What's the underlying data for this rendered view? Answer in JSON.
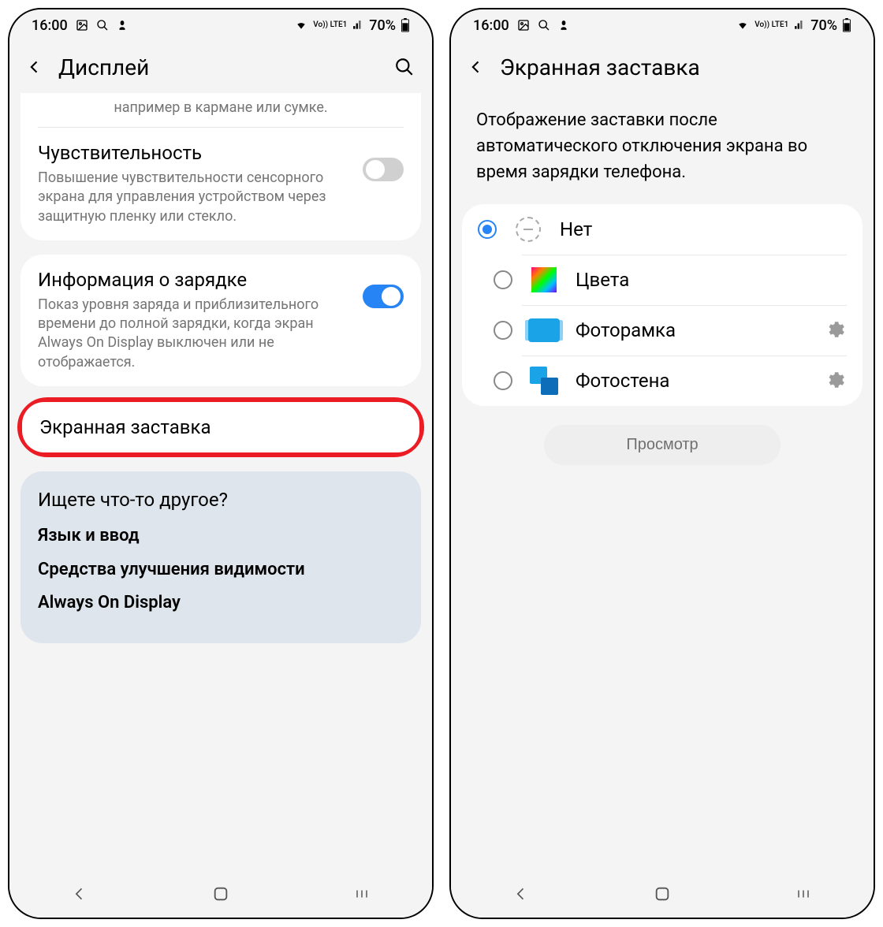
{
  "statusbar": {
    "time": "16:00",
    "network_label": "Vo)) LTE1",
    "battery": "70%"
  },
  "left": {
    "title": "Дисплей",
    "truncated": "например в кармане или сумке.",
    "sensitivity": {
      "title": "Чувствительность",
      "desc": "Повышение чувствительности сенсорного экрана для управления устройством через защитную пленку или стекло."
    },
    "charging": {
      "title": "Информация о зарядке",
      "desc": "Показ уровня заряда и приблизительного времени до полной зарядки, когда экран Always On Display выключен или не отображается."
    },
    "screensaver": {
      "title": "Экранная заставка"
    },
    "hints": {
      "title": "Ищете что-то другое?",
      "item1": "Язык и ввод",
      "item2": "Средства улучшения видимости",
      "item3": "Always On Display"
    }
  },
  "right": {
    "title": "Экранная заставка",
    "desc": "Отображение заставки после автоматического отключения экрана во время зарядки телефона.",
    "options": {
      "none": "Нет",
      "colors": "Цвета",
      "frame": "Фоторамка",
      "wall": "Фотостена"
    },
    "preview": "Просмотр"
  }
}
